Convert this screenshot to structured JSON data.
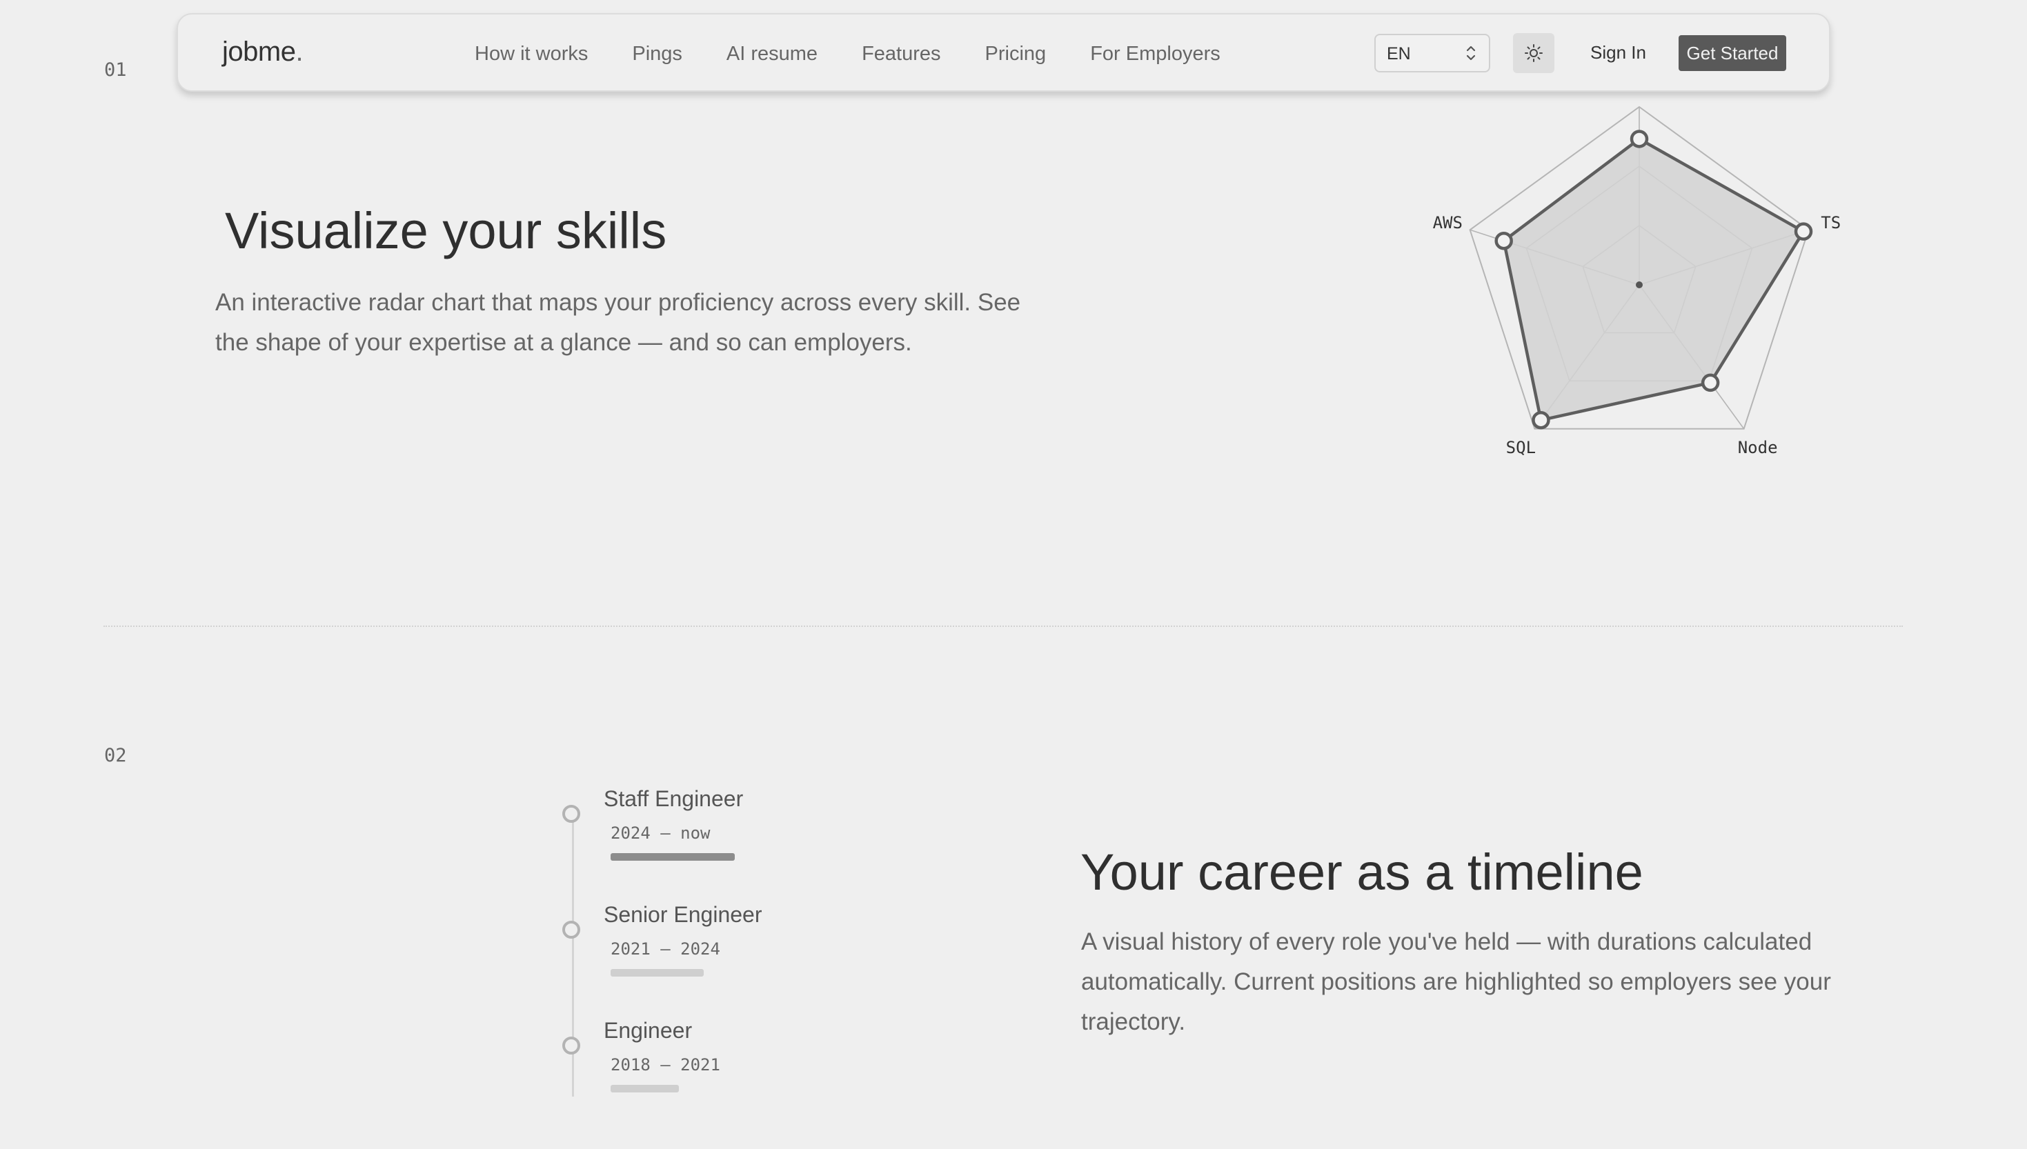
{
  "nav": {
    "logo_primary": "job",
    "logo_secondary": "me",
    "logo_dot": ".",
    "links": [
      "How it works",
      "Pings",
      "AI resume",
      "Features",
      "Pricing",
      "For Employers"
    ],
    "language": "EN",
    "sign_in": "Sign In",
    "get_started": "Get Started"
  },
  "sections": [
    {
      "number": "01",
      "title": "Visualize your skills",
      "body": "An interactive radar chart that maps your proficiency across every skill. See the shape of your expertise at a glance — and so can employers."
    },
    {
      "number": "02",
      "title": "Your career as a timeline",
      "body": "A visual history of every role you've held — with durations calculated automatically. Current positions are highlighted so employers see your trajectory."
    }
  ],
  "radar": {
    "max": 100,
    "axes": [
      "",
      "TS",
      "Node",
      "SQL",
      "AWS"
    ],
    "values": [
      82,
      97,
      68,
      94,
      80
    ],
    "colors": {
      "fill": "#d2d2d2",
      "line": "#5e5e5e",
      "grid": "#b5b5b5"
    }
  },
  "timeline": [
    {
      "title": "Staff Engineer",
      "dates": "2024 — now",
      "duration_fraction": 1.0,
      "current": true
    },
    {
      "title": "Senior Engineer",
      "dates": "2021 — 2024",
      "duration_fraction": 0.75,
      "current": false
    },
    {
      "title": "Engineer",
      "dates": "2018 — 2021",
      "duration_fraction": 0.55,
      "current": false
    }
  ],
  "colors": {
    "background": "#efefef",
    "cta": "#595959",
    "bar_current": "#8c8c8c",
    "bar_past": "#cfcfcf"
  }
}
